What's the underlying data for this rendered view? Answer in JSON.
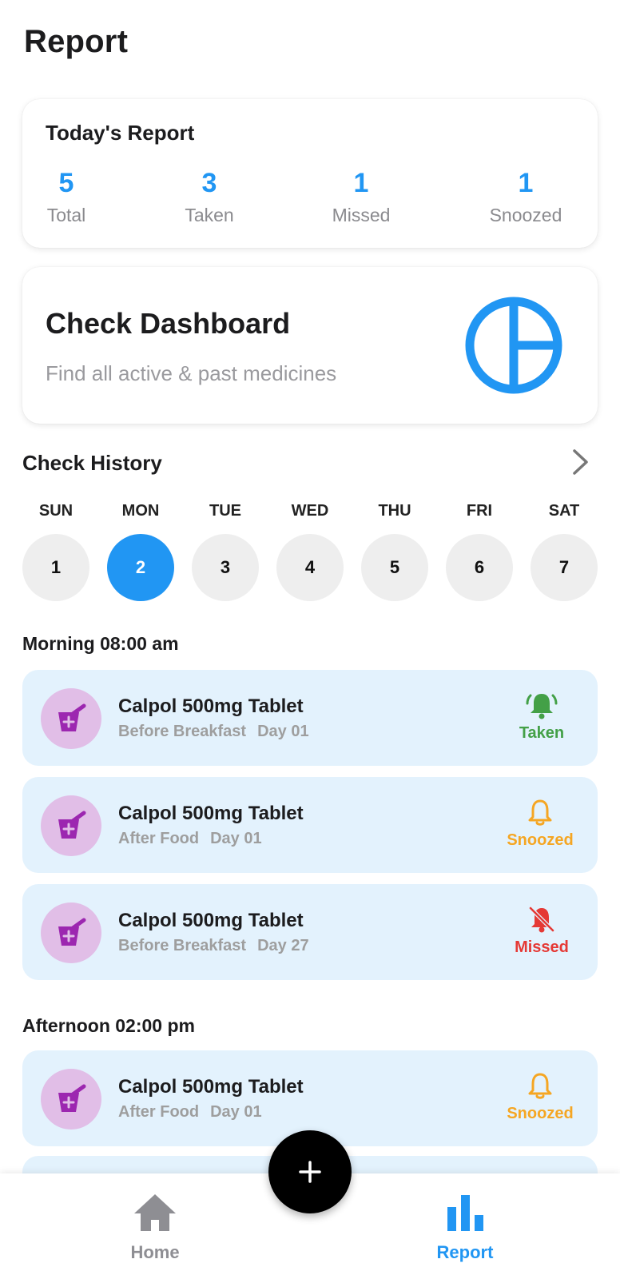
{
  "page": {
    "title": "Report"
  },
  "todays_report": {
    "title": "Today's Report",
    "stats": [
      {
        "value": "5",
        "label": "Total"
      },
      {
        "value": "3",
        "label": "Taken"
      },
      {
        "value": "1",
        "label": "Missed"
      },
      {
        "value": "1",
        "label": "Snoozed"
      }
    ]
  },
  "dashboard": {
    "title": "Check Dashboard",
    "subtitle": "Find all active & past medicines",
    "icon": "pie-chart-icon"
  },
  "history": {
    "title": "Check History",
    "chevron_icon": "chevron-right-icon",
    "days": [
      {
        "name": "SUN",
        "date": "1",
        "selected": false
      },
      {
        "name": "MON",
        "date": "2",
        "selected": true
      },
      {
        "name": "TUE",
        "date": "3",
        "selected": false
      },
      {
        "name": "WED",
        "date": "4",
        "selected": false
      },
      {
        "name": "THU",
        "date": "5",
        "selected": false
      },
      {
        "name": "FRI",
        "date": "6",
        "selected": false
      },
      {
        "name": "SAT",
        "date": "7",
        "selected": false
      }
    ]
  },
  "sections": [
    {
      "label": "Morning 08:00 am",
      "items": [
        {
          "name": "Calpol 500mg Tablet",
          "timing": "Before Breakfast",
          "day": "Day 01",
          "status": "Taken",
          "status_icon": "bell-ringing-icon"
        },
        {
          "name": "Calpol 500mg Tablet",
          "timing": "After Food",
          "day": "Day 01",
          "status": "Snoozed",
          "status_icon": "bell-outline-icon"
        },
        {
          "name": "Calpol 500mg Tablet",
          "timing": "Before Breakfast",
          "day": "Day 27",
          "status": "Missed",
          "status_icon": "bell-off-icon"
        }
      ]
    },
    {
      "label": "Afternoon 02:00 pm",
      "items": [
        {
          "name": "Calpol 500mg Tablet",
          "timing": "After Food",
          "day": "Day 01",
          "status": "Snoozed",
          "status_icon": "bell-outline-icon"
        }
      ]
    }
  ],
  "nav": {
    "items": [
      {
        "label": "Home",
        "icon": "home-icon",
        "active": false
      },
      {
        "label": "Report",
        "icon": "bar-chart-icon",
        "active": true
      }
    ],
    "fab_icon": "plus-icon"
  },
  "colors": {
    "accent": "#2196f3",
    "card_bg": "#e3f2fd",
    "taken": "#43a047",
    "snoozed": "#f5a623",
    "missed": "#e53935",
    "avatar_bg": "#e1bee7",
    "avatar_icon": "#9c27b0"
  }
}
